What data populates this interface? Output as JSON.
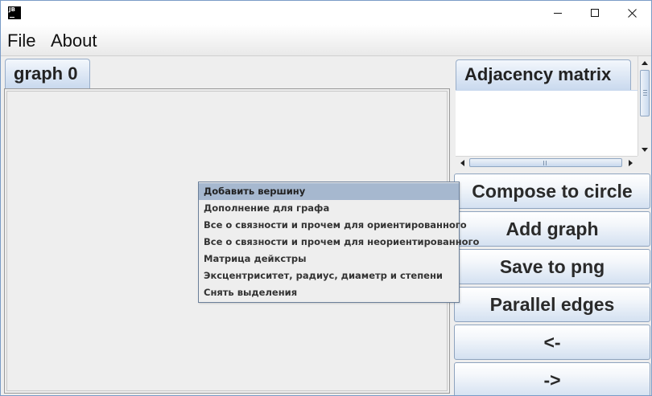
{
  "window": {
    "icon_text": "JB",
    "controls": {
      "minimize": "minimize",
      "maximize": "maximize",
      "close": "close"
    }
  },
  "menubar": {
    "items": [
      "File",
      "About"
    ]
  },
  "graph_tabs": [
    {
      "label": "graph 0",
      "selected": true
    }
  ],
  "matrix_panel": {
    "tab_label": "Adjacency matrix"
  },
  "actions": {
    "compose": "Compose to circle",
    "add_graph": "Add graph",
    "save_png": "Save to png",
    "parallel": "Parallel edges",
    "back": "<-",
    "forward": "->"
  },
  "context_menu": {
    "items": [
      "Добавить вершину",
      "Дополнение для графа",
      "Все о связности и прочем для ориентированного",
      "Все о связности и прочем для неориентированного",
      "Матрица дейкстры",
      "Эксцентриситет, радиус, диаметр и степени",
      "Снять выделения"
    ],
    "highlighted_index": 0
  },
  "colors": {
    "window_border": "#7a9cc7",
    "panel_bg": "#eeeeee",
    "tab_gradient_end": "#c9d9ee",
    "menu_highlight": "#a6b8cf"
  }
}
